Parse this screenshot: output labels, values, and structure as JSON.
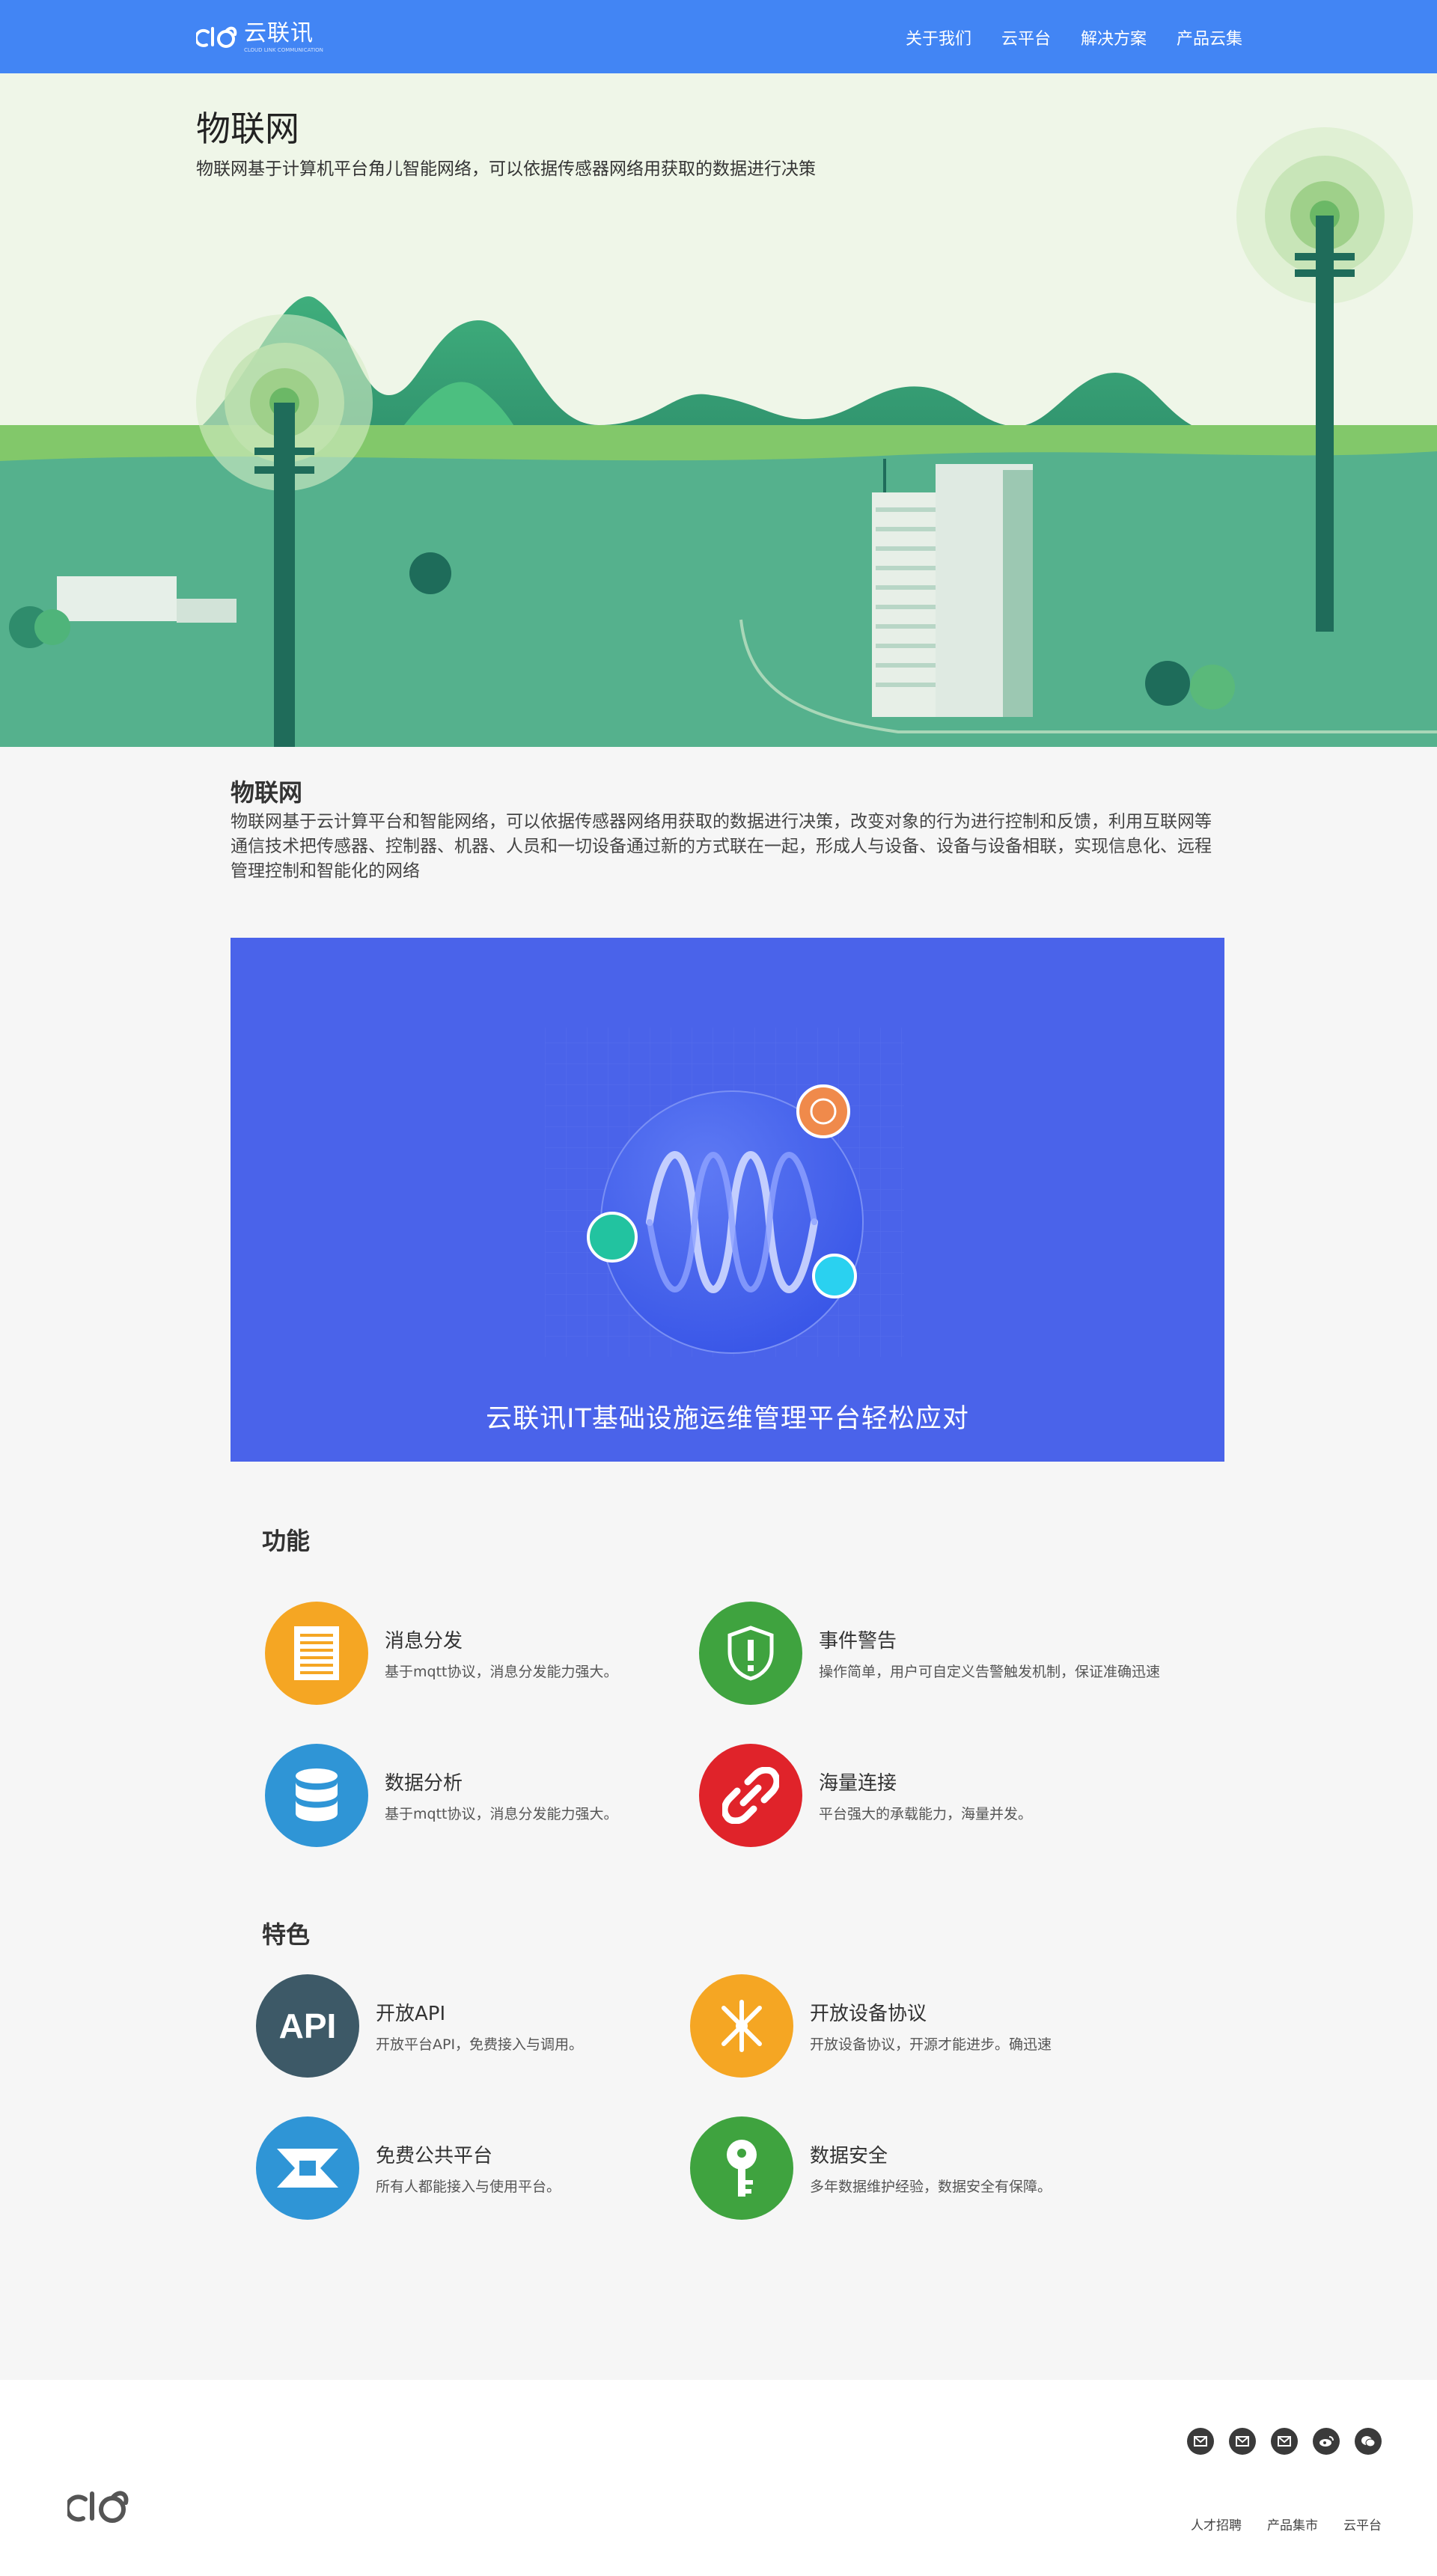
{
  "header": {
    "logo_text": "云联讯",
    "logo_sub": "CLOUD LINK COMMUNICATION",
    "nav": [
      "关于我们",
      "云平台",
      "解决方案",
      "产品云集"
    ],
    "bg_color": "#4285f4"
  },
  "hero": {
    "title": "物联网",
    "subtitle": "物联网基于计算机平台角儿智能网络，可以依据传感器网络用获取的数据进行决策"
  },
  "intro": {
    "title": "物联网",
    "text": "物联网基于云计算平台和智能网络，可以依据传感器网络用获取的数据进行决策，改变对象的行为进行控制和反馈，利用互联网等通信技术把传感器、控制器、机器、人员和一切设备通过新的方式联在一起，形成人与设备、设备与设备相联，实现信息化、远程管理控制和智能化的网络"
  },
  "banner": {
    "caption": "云联讯IT基础设施运维管理平台轻松应对",
    "bg_color": "#4a63ea"
  },
  "features": {
    "title": "功能",
    "items": [
      {
        "name": "消息分发",
        "desc": "基于mqtt协议，消息分发能力强大。",
        "icon": "document-icon",
        "color": "#f5a623"
      },
      {
        "name": "事件警告",
        "desc": "操作简单，用户可自定义告警触发机制，保证准确迅速",
        "icon": "shield-alert-icon",
        "color": "#3fa33f"
      },
      {
        "name": "数据分析",
        "desc": "基于mqtt协议，消息分发能力强大。",
        "icon": "database-icon",
        "color": "#2f95d6"
      },
      {
        "name": "海量连接",
        "desc": "平台强大的承载能力，海量并发。",
        "icon": "link-icon",
        "color": "#e0232a"
      }
    ]
  },
  "traits": {
    "title": "特色",
    "items": [
      {
        "name": "开放API",
        "desc": "开放平台API，免费接入与调用。",
        "icon": "api-icon",
        "icon_text": "API",
        "color": "#3d5967"
      },
      {
        "name": "开放设备协议",
        "desc": "开放设备协议，开源才能进步。确迅速",
        "icon": "tools-icon",
        "color": "#f5a623"
      },
      {
        "name": "免费公共平台",
        "desc": "所有人都能接入与使用平台。",
        "icon": "platform-icon",
        "color": "#2f95d6"
      },
      {
        "name": "数据安全",
        "desc": "多年数据维护经验，数据安全有保障。",
        "icon": "key-icon",
        "color": "#3fa33f"
      }
    ]
  },
  "footer": {
    "links": [
      "人才招聘",
      "产品集市",
      "云平台"
    ],
    "social": [
      "mail-icon",
      "mail-icon",
      "mail-icon",
      "weibo-icon",
      "wechat-icon"
    ]
  }
}
